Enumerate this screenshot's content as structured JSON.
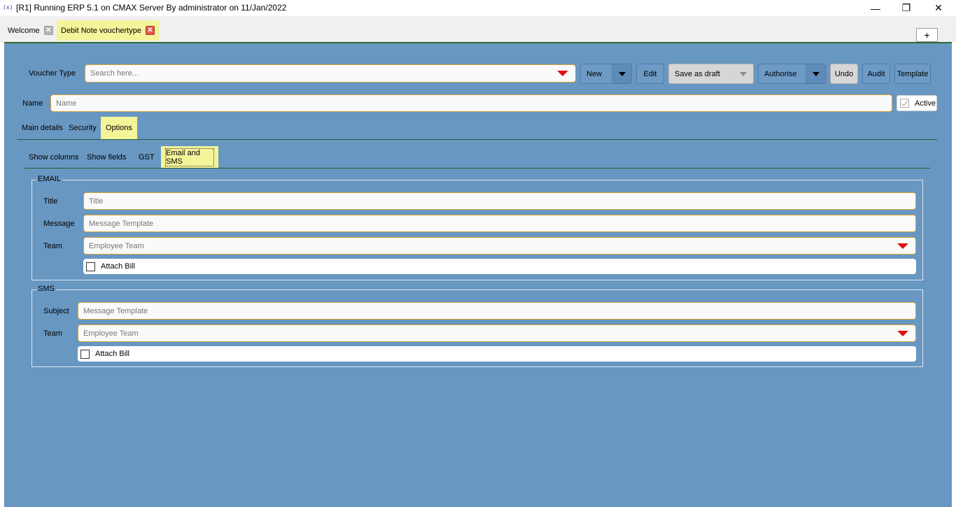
{
  "window": {
    "icon": "(x)",
    "title": "[R1] Running ERP 5.1 on CMAX Server By administrator on 11/Jan/2022",
    "minimize": "—",
    "restore": "❐",
    "close": "✕"
  },
  "tabs": [
    {
      "label": "Welcome",
      "close": "✕"
    },
    {
      "label": "Debit Note vouchertype",
      "close": "✕"
    }
  ],
  "add_tab": "+",
  "header": {
    "voucher_type_label": "Voucher Type",
    "voucher_type_placeholder": "Search here...",
    "name_label": "Name",
    "name_placeholder": "Name",
    "active_label": "Active",
    "active_checked": true
  },
  "toolbar": {
    "new": "New",
    "edit": "Edit",
    "save_as_draft": "Save as draft",
    "authorise": "Authorise",
    "undo": "Undo",
    "audit": "Audit",
    "template": "Template"
  },
  "main_tabs": [
    "Main details",
    "Security",
    "Options"
  ],
  "main_tab_selected": "Options",
  "option_tabs": [
    "Show columns",
    "Show fields",
    "GST",
    "Email and SMS"
  ],
  "option_tab_selected": "Email and SMS",
  "email": {
    "legend": "EMAIL",
    "title_label": "Title",
    "title_placeholder": "Title",
    "message_label": "Message",
    "message_placeholder": "Message Template",
    "team_label": "Team",
    "team_placeholder": "Employee Team",
    "attach_bill_label": "Attach Bill",
    "attach_bill_checked": false
  },
  "sms": {
    "legend": "SMS",
    "subject_label": "Subject",
    "subject_placeholder": "Message Template",
    "team_label": "Team",
    "team_placeholder": "Employee Team",
    "attach_bill_label": "Attach Bill",
    "attach_bill_checked": false
  },
  "colors": {
    "panel": "#6897c2",
    "selected_tab": "#f4f49a",
    "field_border": "#d7a33a",
    "dropdown_arrow": "#e01010",
    "divider": "#1e5e2e"
  }
}
